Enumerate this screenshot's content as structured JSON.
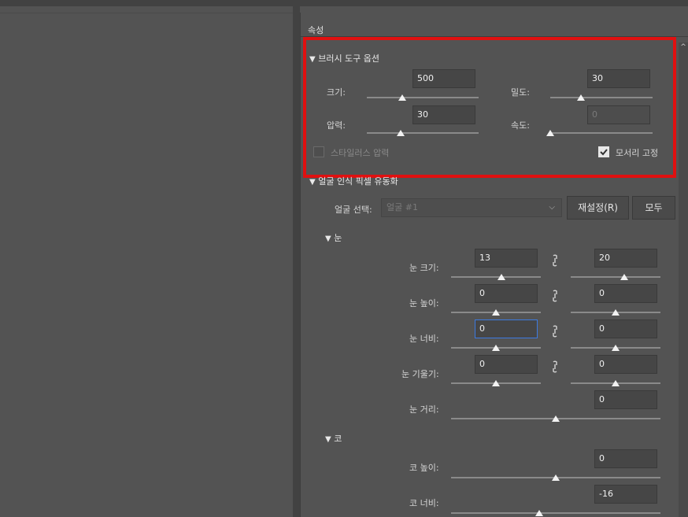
{
  "panel": {
    "title": "속성"
  },
  "brush": {
    "header": "브러시 도구 옵션",
    "size": {
      "label": "크기:",
      "value": "500",
      "level": 0.32
    },
    "density": {
      "label": "밀도:",
      "value": "30",
      "level": 0.3
    },
    "pressure": {
      "label": "압력:",
      "value": "30",
      "level": 0.3
    },
    "rate": {
      "label": "속도:",
      "value": "0",
      "level": 0.0
    },
    "stylus": {
      "label": "스타일러스 압력",
      "checked": false
    },
    "pin_edges": {
      "label": "모서리 고정",
      "checked": true
    }
  },
  "face": {
    "header": "얼굴 인식 픽셀 유동화",
    "select_label": "얼굴 선택:",
    "select_value": "얼굴 #1",
    "reset_label": "재설정(R)",
    "all_label": "모두"
  },
  "eyes": {
    "header": "눈",
    "rows": [
      {
        "label": "눈 크기:",
        "left": "13",
        "right": "20"
      },
      {
        "label": "눈 높이:",
        "left": "0",
        "right": "0"
      },
      {
        "label": "눈 너비:",
        "left": "0",
        "right": "0"
      },
      {
        "label": "눈 기울기:",
        "left": "0",
        "right": "0"
      },
      {
        "label": "눈 거리:",
        "single": "0"
      }
    ]
  },
  "nose": {
    "header": "코",
    "rows": [
      {
        "label": "코 높이:",
        "single": "0"
      },
      {
        "label": "코 너비:",
        "single": "-16"
      }
    ]
  },
  "icons": {
    "collapse": "triangle-down-icon",
    "link": "chain-link-icon",
    "check": "checkmark-icon",
    "chevron": "chevron-down-icon",
    "scroll": "scroll-up-icon"
  },
  "colors": {
    "highlight": "#e01010",
    "active_field": "#3c7ae0"
  }
}
